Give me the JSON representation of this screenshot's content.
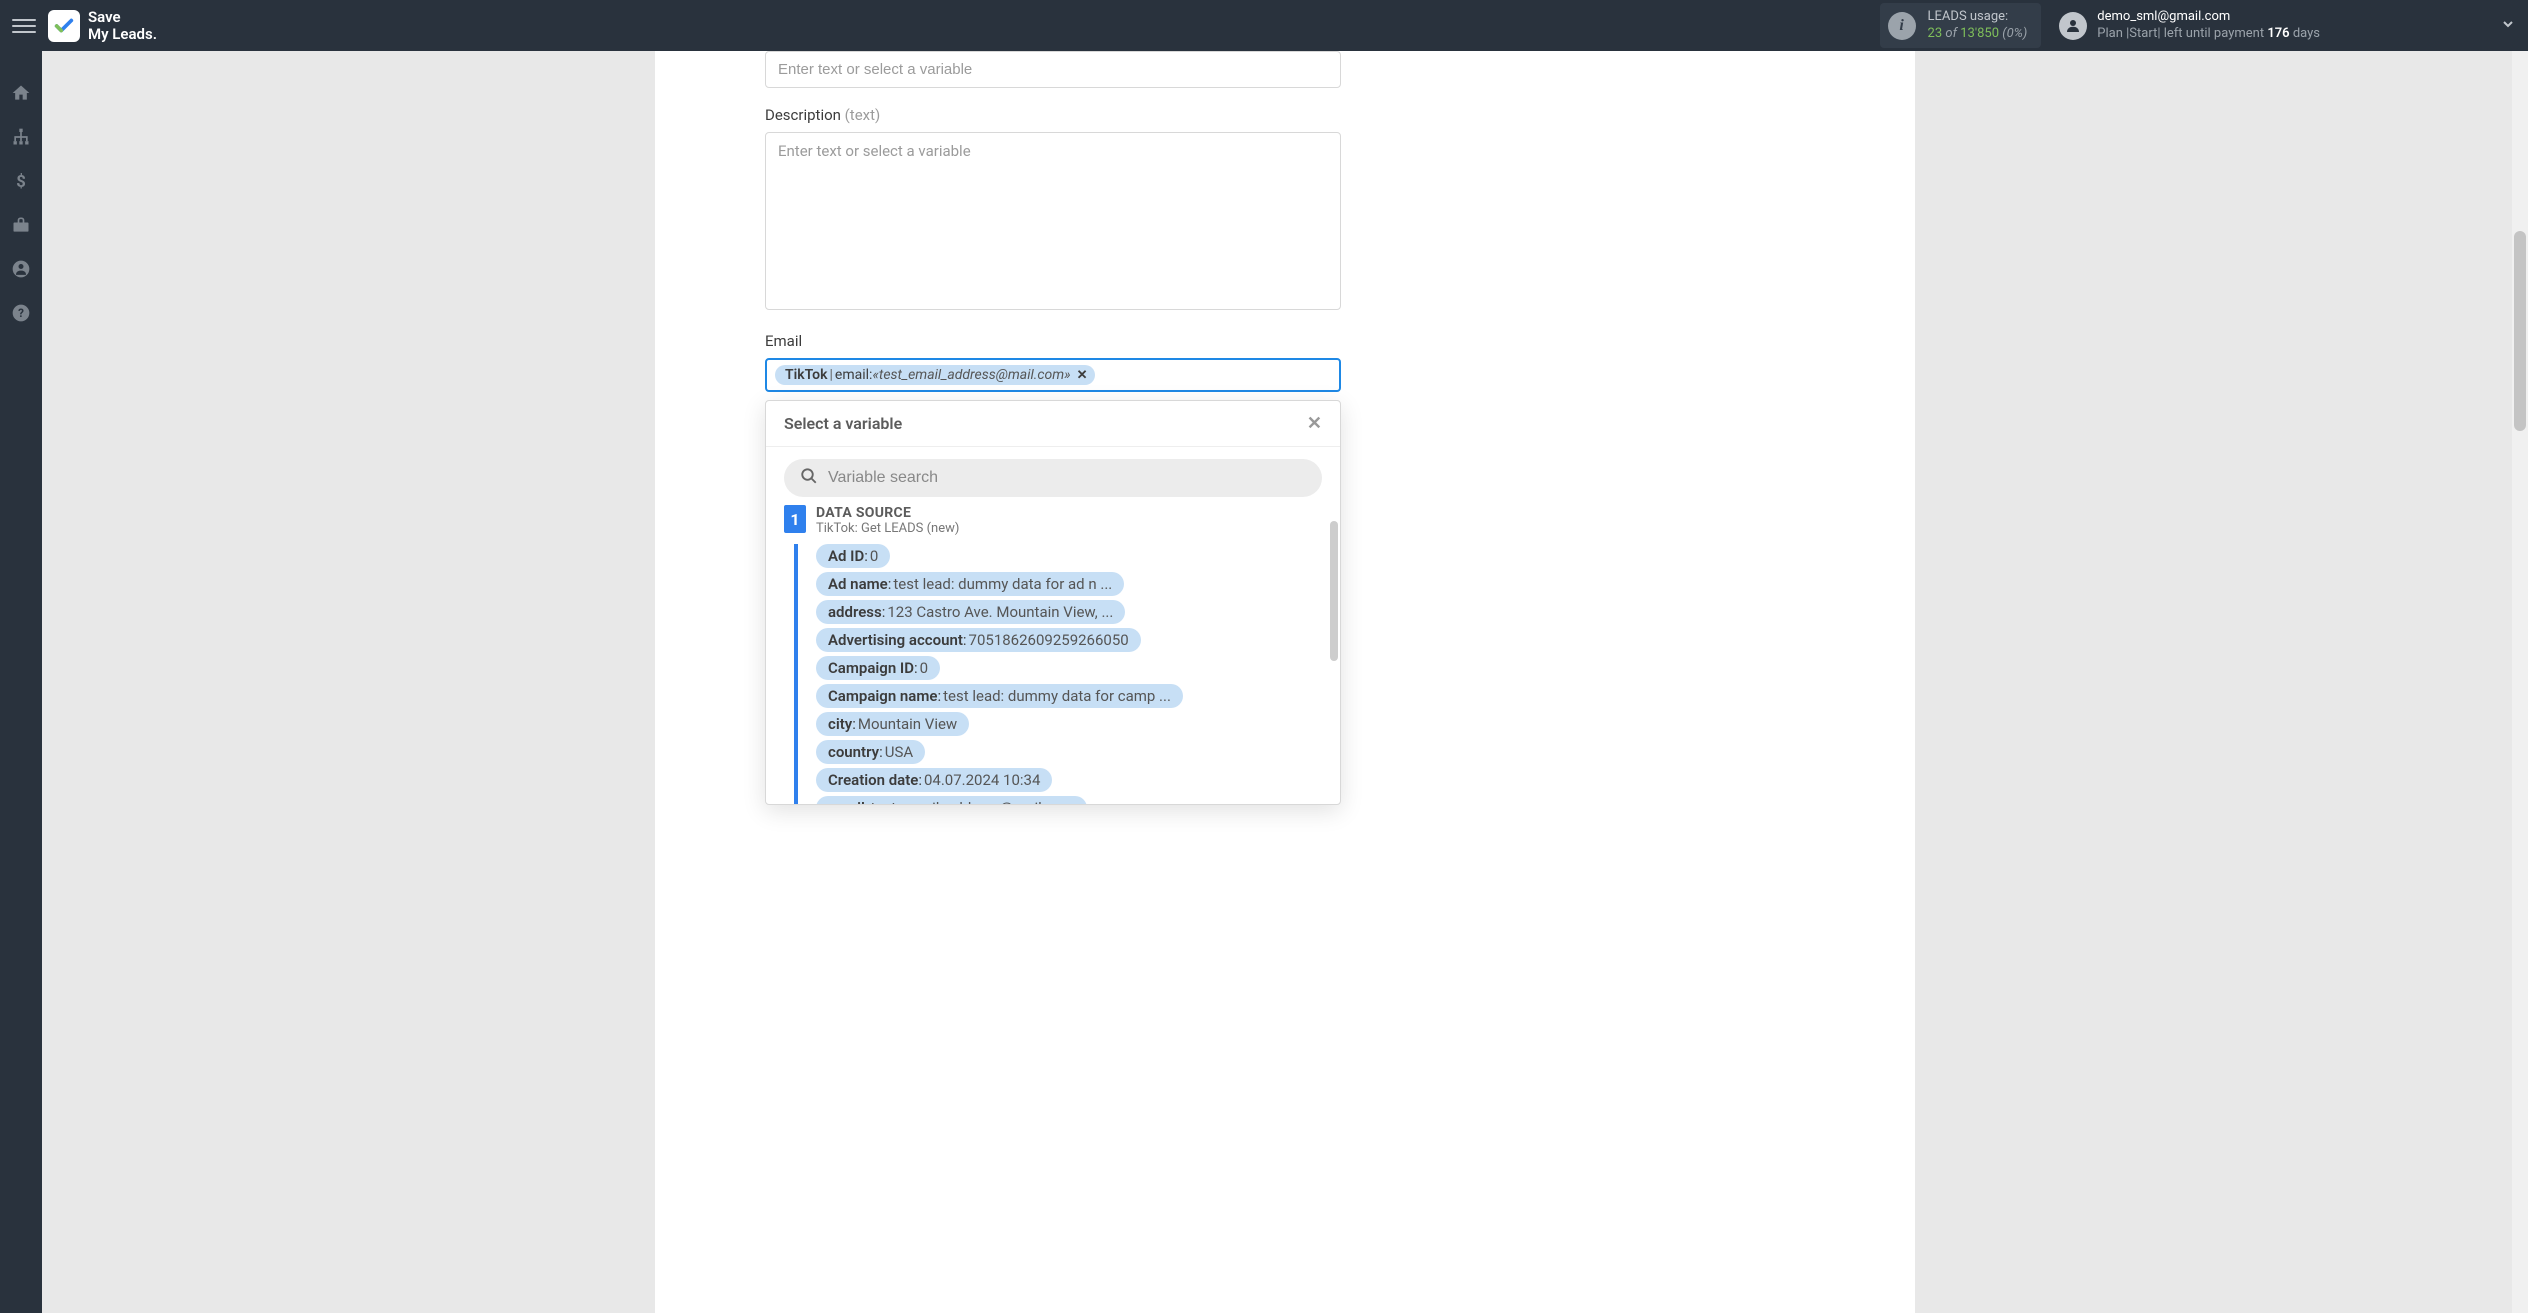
{
  "header": {
    "logo_line1": "Save",
    "logo_line2": "My Leads.",
    "usage_label": "LEADS usage:",
    "usage_current": "23",
    "usage_of": "of",
    "usage_total": "13'850",
    "usage_pct": "(0%)",
    "user_email": "demo_sml@gmail.com",
    "plan_prefix": "Plan |Start| left until payment",
    "plan_days": "176",
    "plan_suffix": "days"
  },
  "fields": {
    "top_placeholder": "Enter text or select a variable",
    "description_label": "Description",
    "description_hint": "(text)",
    "description_placeholder": "Enter text or select a variable",
    "email_label": "Email",
    "email_token_source": "TikTok",
    "email_token_field": "email:",
    "email_token_value": "«test_email_address@mail.com»"
  },
  "dropdown": {
    "title": "Select a variable",
    "search_placeholder": "Variable search",
    "source_num": "1",
    "source_title": "DATA SOURCE",
    "source_sub": "TikTok: Get LEADS (new)",
    "vars": [
      {
        "name": "Ad ID",
        "value": "0"
      },
      {
        "name": "Ad name",
        "value": "test lead: dummy data for ad n ..."
      },
      {
        "name": "address",
        "value": "123 Castro Ave. Mountain View, ..."
      },
      {
        "name": "Advertising account",
        "value": "7051862609259266050"
      },
      {
        "name": "Campaign ID",
        "value": "0"
      },
      {
        "name": "Campaign name",
        "value": "test lead: dummy data for camp ..."
      },
      {
        "name": "city",
        "value": "Mountain View"
      },
      {
        "name": "country",
        "value": "USA"
      },
      {
        "name": "Creation date",
        "value": "04.07.2024 10:34"
      },
      {
        "name": "email",
        "value": "test_email_address@mail.com"
      }
    ]
  }
}
